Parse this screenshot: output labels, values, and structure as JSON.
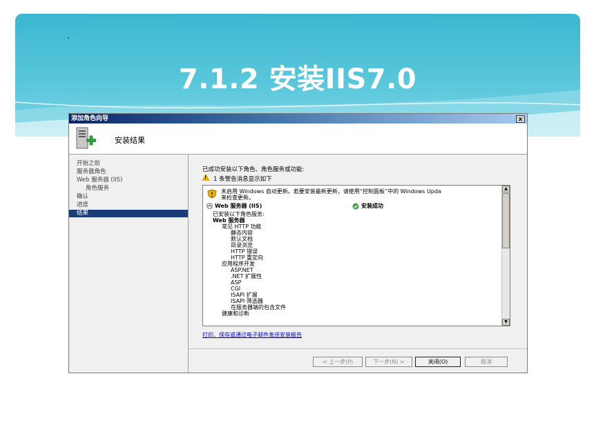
{
  "slide": {
    "title": "7.1.2 安装IIS7.0"
  },
  "dialog": {
    "window_title": "添加角色向导",
    "close_label": "x",
    "header_title": "安装结果",
    "nav": [
      {
        "label": "开始之前"
      },
      {
        "label": "服务器角色"
      },
      {
        "label": "Web 服务器 (IIS)"
      },
      {
        "label": "角色服务"
      },
      {
        "label": "确认"
      },
      {
        "label": "进度"
      },
      {
        "label": "结果"
      }
    ],
    "summary_text": "已成功安装以下角色、角色服务或功能:",
    "warning_text": "1 条警告消息显示如下",
    "result": {
      "warning_line1": "未启用 Windows 自动更新。若要安装最新更新，请使用“控制面板”中的 Windows Upda",
      "warning_line2": "来检查更新。",
      "role_name": "Web 服务器 (IIS)",
      "status": "安装成功",
      "installed_header": "已安装以下角色服务:",
      "section": "Web 服务器",
      "items": [
        {
          "text": "常见 HTTP 功能",
          "level": 1
        },
        {
          "text": "静态内容",
          "level": 2
        },
        {
          "text": "默认文档",
          "level": 2
        },
        {
          "text": "目录浏览",
          "level": 2
        },
        {
          "text": "HTTP 错误",
          "level": 2
        },
        {
          "text": "HTTP 重定向",
          "level": 2
        },
        {
          "text": "应用程序开发",
          "level": 1
        },
        {
          "text": "ASP.NET",
          "level": 2
        },
        {
          "text": ".NET 扩展性",
          "level": 2
        },
        {
          "text": "ASP",
          "level": 2
        },
        {
          "text": "CGI",
          "level": 2
        },
        {
          "text": "ISAPI 扩展",
          "level": 2
        },
        {
          "text": "ISAPI 筛选器",
          "level": 2
        },
        {
          "text": "在服务器端的包含文件",
          "level": 2
        },
        {
          "text": "健康和诊断",
          "level": 1
        }
      ]
    },
    "link_text": "打印、保存或通过电子邮件发送安装报告",
    "buttons": {
      "prev": "< 上一步(P)",
      "next": "下一步(N) >",
      "close": "关闭(O)",
      "cancel": "取消"
    }
  },
  "colors": {
    "banner": "#3ab7cf",
    "titlebar": "#0a246a",
    "nav_selected": "#1a3d7a",
    "link": "#0000cc"
  }
}
